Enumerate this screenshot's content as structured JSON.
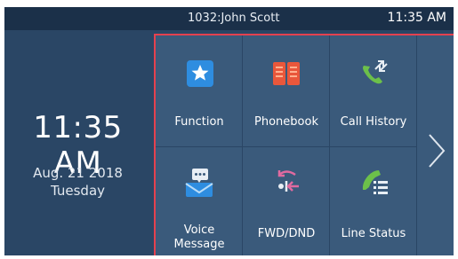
{
  "status_bar": {
    "user": "1032:John Scott",
    "time": "11:35 AM"
  },
  "clock": {
    "time": "11:35 AM",
    "date": "Aug. 21 2018",
    "weekday": "Tuesday"
  },
  "menu": {
    "items": [
      {
        "label": "Function",
        "icon": "star-icon"
      },
      {
        "label": "Phonebook",
        "icon": "book-icon"
      },
      {
        "label": "Call History",
        "icon": "call-history-icon"
      },
      {
        "label": "Voice Message",
        "label_line1": "Voice",
        "label_line2": "Message",
        "icon": "voicemail-icon"
      },
      {
        "label": "FWD/DND",
        "icon": "forward-dnd-icon"
      },
      {
        "label": "Line Status",
        "icon": "line-status-icon"
      }
    ],
    "next_icon": "chevron-right-icon"
  },
  "colors": {
    "background": "#2a4665",
    "status_bar": "#1b3049",
    "tile": "#3a5a7b",
    "highlight_border": "#e5414f",
    "accent_green": "#6cc04a",
    "accent_orange": "#e9573b",
    "accent_blue": "#2e8de0",
    "accent_pink": "#e06aa0"
  }
}
